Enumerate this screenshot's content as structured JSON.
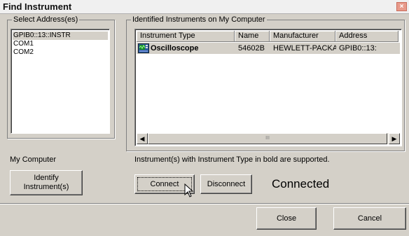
{
  "window": {
    "title": "Find Instrument",
    "close_glyph": "×"
  },
  "select_group": {
    "label": "Select Address(es)",
    "addresses": [
      "GPIB0::13::INSTR",
      "COM1",
      "COM2"
    ],
    "selected_index": 0
  },
  "identified_group": {
    "label": "Identified Instruments on My Computer",
    "columns": [
      "Instrument Type",
      "Name",
      "Manufacturer",
      "Address"
    ],
    "rows": [
      {
        "type": "Oscilloscope",
        "name": "54602B",
        "manufacturer": "HEWLETT-PACKA...",
        "address": "GPIB0::13:",
        "icon": "oscilloscope-icon"
      }
    ],
    "scroll_grip": "III"
  },
  "left": {
    "my_computer_label": "My Computer",
    "identify_button_label": "Identify\nInstrument(s)"
  },
  "right": {
    "note": "Instrument(s) with Instrument Type in bold are supported.",
    "connect_label": "Connect",
    "disconnect_label": "Disconnect",
    "status": "Connected"
  },
  "footer": {
    "close_label": "Close",
    "cancel_label": "Cancel"
  }
}
